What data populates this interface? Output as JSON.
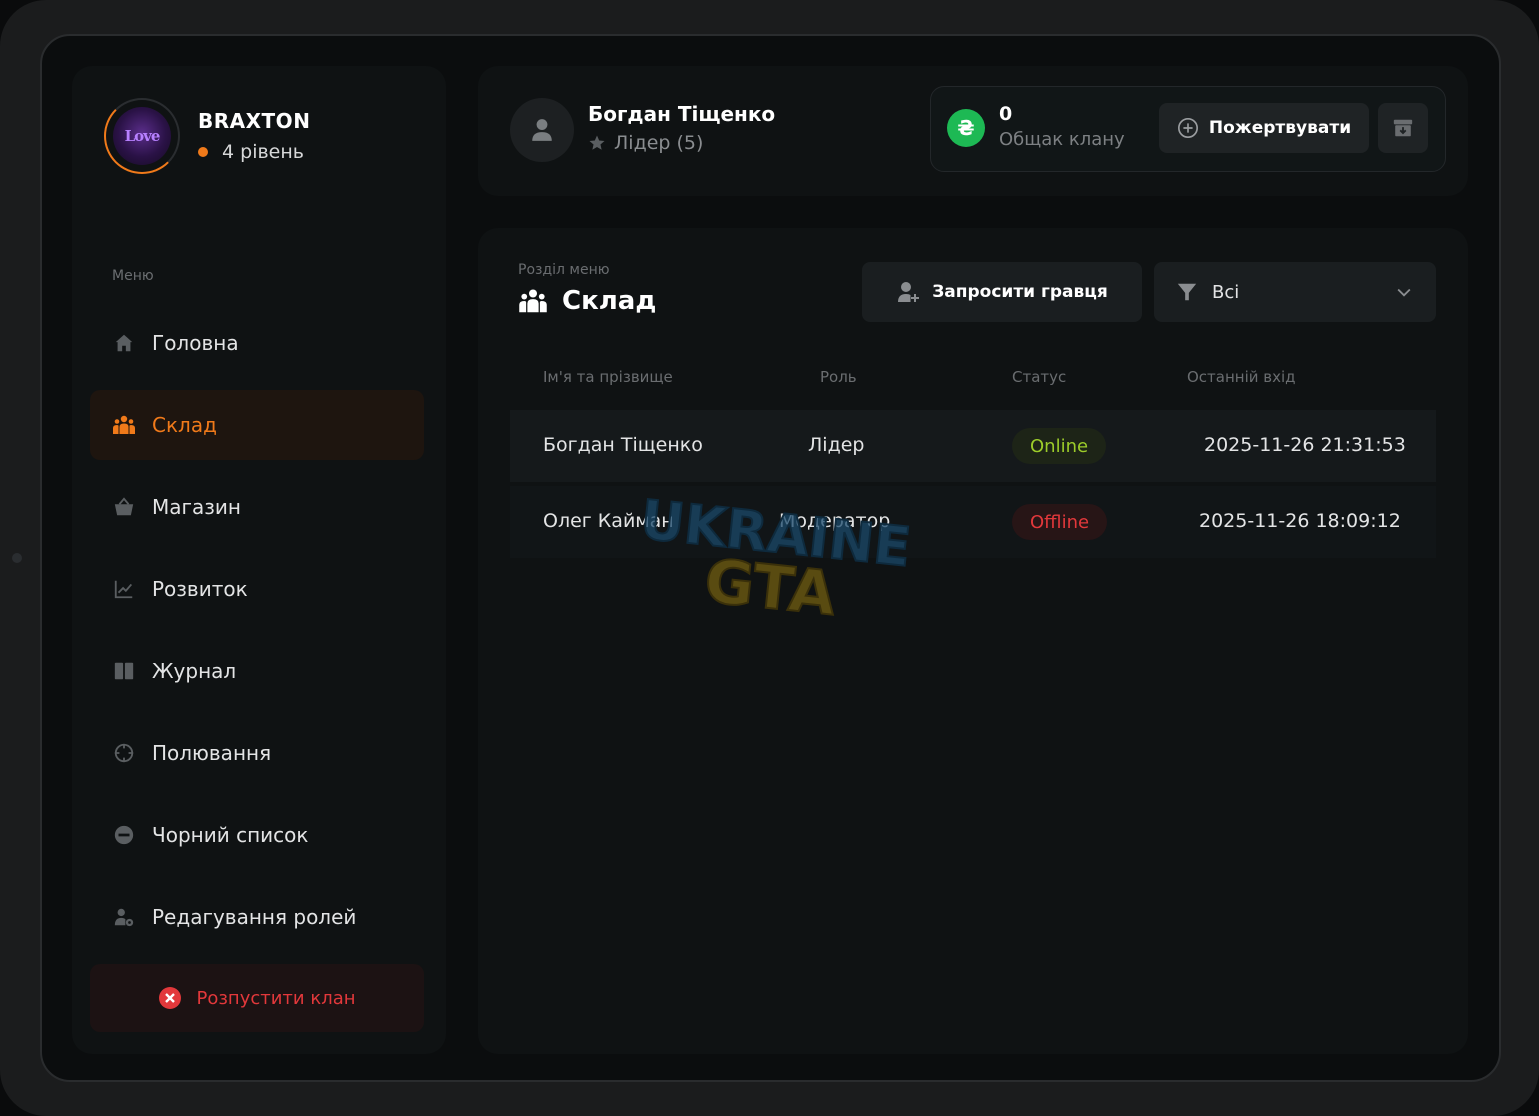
{
  "profile": {
    "name": "BRAXTON",
    "level": "4 рівень",
    "avatar_text": "Love"
  },
  "menu": {
    "label": "Меню",
    "items": [
      {
        "label": "Головна",
        "icon": "home-icon"
      },
      {
        "label": "Склад",
        "icon": "users-icon",
        "active": true
      },
      {
        "label": "Магазин",
        "icon": "basket-icon"
      },
      {
        "label": "Розвиток",
        "icon": "chart-icon"
      },
      {
        "label": "Журнал",
        "icon": "book-icon"
      },
      {
        "label": "Полювання",
        "icon": "crosshair-icon"
      },
      {
        "label": "Чорний список",
        "icon": "minus-circle-icon"
      },
      {
        "label": "Редагування ролей",
        "icon": "user-gear-icon"
      }
    ],
    "disband": "Розпустити клан"
  },
  "header": {
    "user_name": "Богдан Тіщенко",
    "user_role": "Лідер (5)",
    "bank_amount": "0",
    "bank_label": "Общак клану",
    "coin_symbol": "₴",
    "donate_label": "Пожертвувати"
  },
  "section": {
    "caption": "Розділ меню",
    "title": "Склад",
    "invite_label": "Запросити гравця",
    "filter_value": "Всі"
  },
  "table": {
    "columns": [
      "Ім'я та прізвище",
      "Роль",
      "Статус",
      "Останній вхід"
    ],
    "rows": [
      {
        "name": "Богдан Тіщенко",
        "role": "Лідер",
        "status": "Online",
        "last_login": "2025-11-26 21:31:53"
      },
      {
        "name": "Олег Кайман",
        "role": "Модератор",
        "status": "Offline",
        "last_login": "2025-11-26 18:09:12"
      }
    ]
  },
  "watermark": {
    "line1": "UKRAINE",
    "line2": "GTA"
  },
  "colors": {
    "accent": "#f07a1a",
    "online": "#9ccc2a",
    "offline": "#e2383b",
    "coin": "#1db954"
  }
}
